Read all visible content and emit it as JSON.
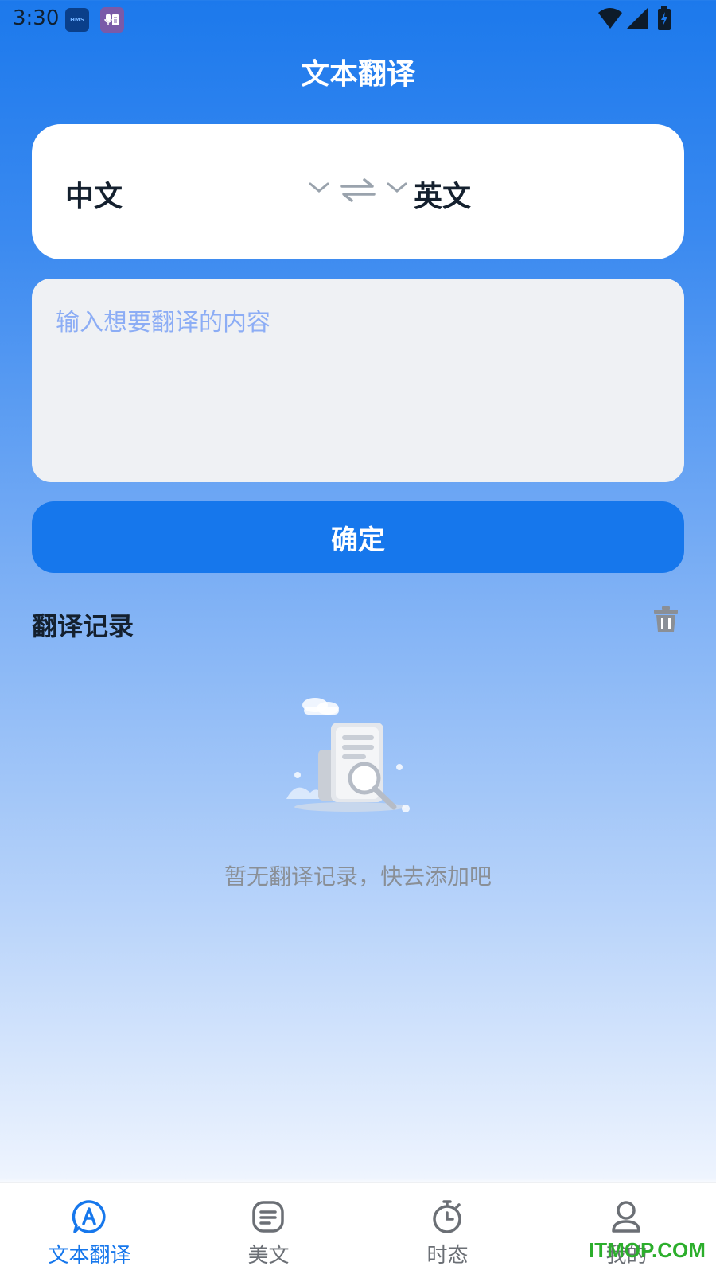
{
  "status_bar": {
    "time": "3:30",
    "hms_label": "HMS"
  },
  "header": {
    "title": "文本翻译"
  },
  "language_selector": {
    "source": "中文",
    "target": "英文"
  },
  "input": {
    "placeholder": "输入想要翻译的内容",
    "value": ""
  },
  "confirm_button": {
    "label": "确定"
  },
  "history": {
    "title": "翻译记录",
    "empty_message": "暂无翻译记录，快去添加吧"
  },
  "bottom_nav": {
    "items": [
      {
        "label": "文本翻译",
        "icon": "translate-icon",
        "active": true
      },
      {
        "label": "美文",
        "icon": "article-icon",
        "active": false
      },
      {
        "label": "时态",
        "icon": "stopwatch-icon",
        "active": false
      },
      {
        "label": "我的",
        "icon": "profile-icon",
        "active": false
      }
    ]
  },
  "watermark": "ITMOP.COM",
  "colors": {
    "primary": "#1677ec",
    "text_dark": "#14202e",
    "placeholder": "#8cadf5",
    "muted": "#8a8f96"
  }
}
